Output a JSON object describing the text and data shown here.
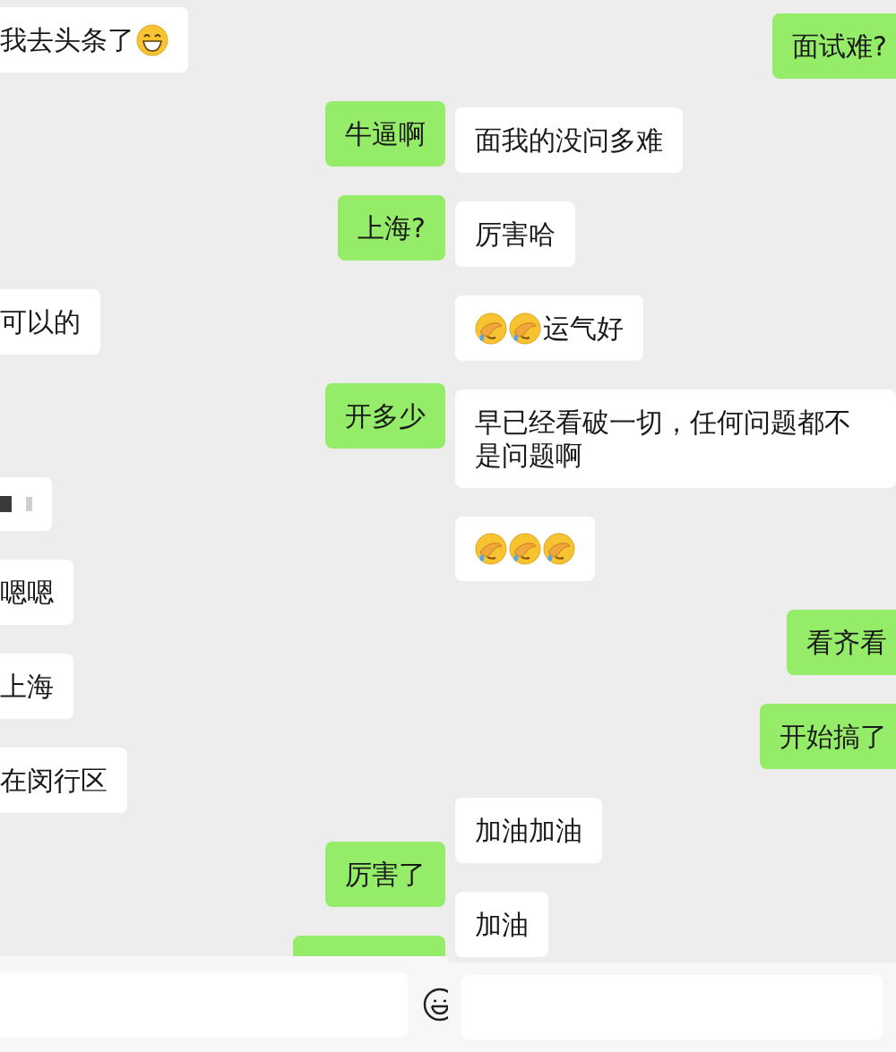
{
  "panels": [
    {
      "messages": [
        {
          "outgoing": false,
          "kind": "text",
          "parts": [
            {
              "kind": "text",
              "text": "我去头条了"
            },
            {
              "kind": "grin"
            }
          ]
        },
        {
          "outgoing": true,
          "kind": "text",
          "parts": [
            {
              "kind": "text",
              "text": "牛逼啊"
            }
          ]
        },
        {
          "outgoing": true,
          "kind": "text",
          "parts": [
            {
              "kind": "text",
              "text": "上海?"
            }
          ]
        },
        {
          "outgoing": false,
          "kind": "text",
          "parts": [
            {
              "kind": "text",
              "text": "可以的"
            }
          ]
        },
        {
          "outgoing": true,
          "kind": "text",
          "parts": [
            {
              "kind": "text",
              "text": "开多少"
            }
          ]
        },
        {
          "outgoing": false,
          "kind": "redacted"
        },
        {
          "outgoing": false,
          "kind": "text",
          "parts": [
            {
              "kind": "text",
              "text": "嗯嗯"
            }
          ]
        },
        {
          "outgoing": false,
          "kind": "text",
          "parts": [
            {
              "kind": "text",
              "text": "上海"
            }
          ]
        },
        {
          "outgoing": false,
          "kind": "text",
          "parts": [
            {
              "kind": "text",
              "text": "在闵行区"
            }
          ]
        },
        {
          "outgoing": true,
          "kind": "text",
          "parts": [
            {
              "kind": "text",
              "text": "厉害了"
            }
          ]
        },
        {
          "outgoing": true,
          "kind": "clipped"
        }
      ],
      "emoji_button": true
    },
    {
      "messages": [
        {
          "outgoing": true,
          "kind": "text",
          "parts": [
            {
              "kind": "text",
              "text": "面试难?"
            }
          ]
        },
        {
          "outgoing": false,
          "kind": "text",
          "parts": [
            {
              "kind": "text",
              "text": "面我的没问多难"
            }
          ]
        },
        {
          "outgoing": false,
          "kind": "text",
          "parts": [
            {
              "kind": "text",
              "text": "厉害哈"
            }
          ]
        },
        {
          "outgoing": false,
          "kind": "text",
          "parts": [
            {
              "kind": "cover"
            },
            {
              "kind": "cover"
            },
            {
              "kind": "text",
              "text": "运气好"
            }
          ]
        },
        {
          "outgoing": false,
          "kind": "text",
          "parts": [
            {
              "kind": "text",
              "text": "早已经看破一切，任何问题都不是问题啊"
            }
          ]
        },
        {
          "outgoing": false,
          "kind": "text",
          "parts": [
            {
              "kind": "cover"
            },
            {
              "kind": "cover"
            },
            {
              "kind": "cover"
            }
          ]
        },
        {
          "outgoing": true,
          "kind": "text",
          "parts": [
            {
              "kind": "text",
              "text": "看齐看"
            }
          ]
        },
        {
          "outgoing": true,
          "kind": "text",
          "parts": [
            {
              "kind": "text",
              "text": "开始搞了"
            }
          ]
        },
        {
          "outgoing": false,
          "kind": "text",
          "parts": [
            {
              "kind": "text",
              "text": "加油加油"
            }
          ]
        },
        {
          "outgoing": false,
          "kind": "text",
          "parts": [
            {
              "kind": "text",
              "text": "加油"
            }
          ]
        }
      ],
      "emoji_button": false
    }
  ]
}
